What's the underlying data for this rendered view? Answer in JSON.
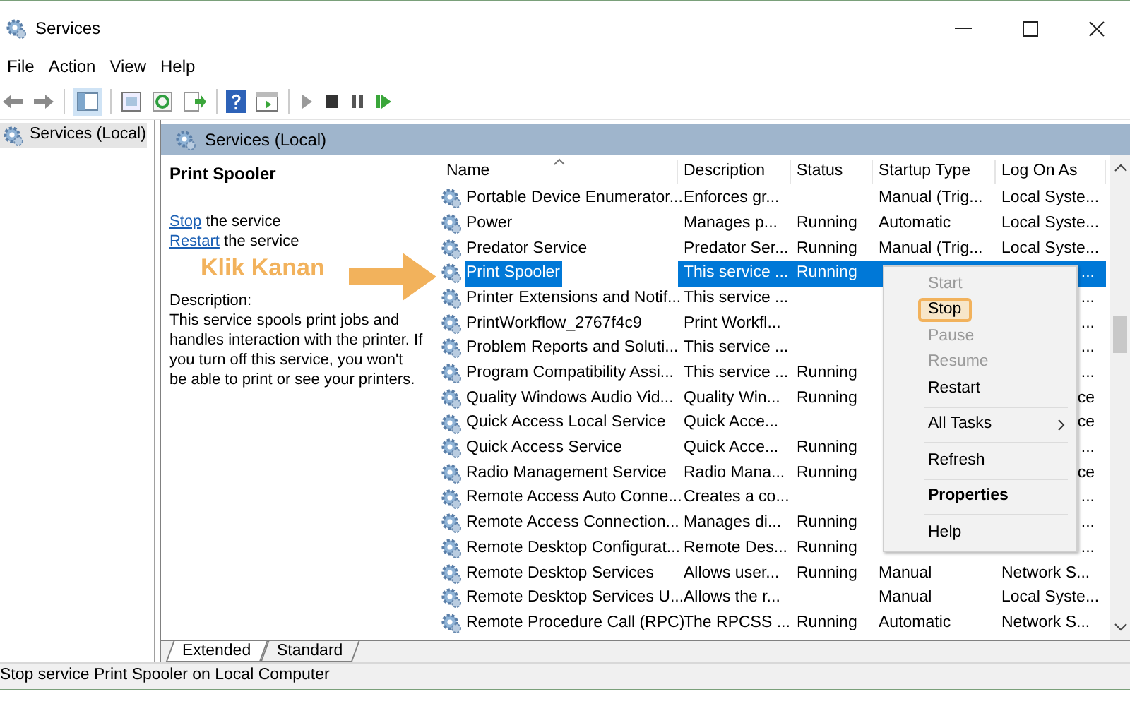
{
  "window": {
    "title": "Services"
  },
  "menu_bar": [
    "File",
    "Action",
    "View",
    "Help"
  ],
  "tree": [
    {
      "label": "Services (Local)",
      "selected": true
    }
  ],
  "pane_header": "Services (Local)",
  "details": {
    "title": "Print Spooler",
    "actions": [
      {
        "link": "Stop",
        "text": "the service"
      },
      {
        "link": "Restart",
        "text": "the service"
      }
    ],
    "description_label": "Description:",
    "description": "This service spools print jobs and handles interaction with the printer. If you turn off this service, you won't be able to print or see your printers."
  },
  "annotation": {
    "text": "Klik Kanan"
  },
  "table": {
    "columns": [
      "Name",
      "Description",
      "Status",
      "Startup Type",
      "Log On As"
    ],
    "rows": [
      {
        "name": "Portable Device Enumerator...",
        "description": "Enforces gr...",
        "status": "",
        "startup": "Manual (Trig...",
        "logon": "Local Syste...",
        "selected": false,
        "covered": false
      },
      {
        "name": "Power",
        "description": "Manages p...",
        "status": "Running",
        "startup": "Automatic",
        "logon": "Local Syste...",
        "selected": false,
        "covered": false
      },
      {
        "name": "Predator Service",
        "description": "Predator Ser...",
        "status": "Running",
        "startup": "Manual (Trig...",
        "logon": "Local Syste...",
        "selected": false,
        "covered": false
      },
      {
        "name": "Print Spooler",
        "description": "This service ...",
        "status": "Running",
        "startup": "",
        "logon": "...",
        "selected": true,
        "covered": true
      },
      {
        "name": "Printer Extensions and Notif...",
        "description": "This service ...",
        "status": "",
        "startup": "",
        "logon": "...",
        "selected": false,
        "covered": true
      },
      {
        "name": "PrintWorkflow_2767f4c9",
        "description": "Print Workfl...",
        "status": "",
        "startup": "",
        "logon": "...",
        "selected": false,
        "covered": true
      },
      {
        "name": "Problem Reports and Soluti...",
        "description": "This service ...",
        "status": "",
        "startup": "",
        "logon": "...",
        "selected": false,
        "covered": true
      },
      {
        "name": "Program Compatibility Assi...",
        "description": "This service ...",
        "status": "Running",
        "startup": "",
        "logon": "...",
        "selected": false,
        "covered": true
      },
      {
        "name": "Quality Windows Audio Vid...",
        "description": "Quality Win...",
        "status": "Running",
        "startup": "",
        "logon": "ce",
        "selected": false,
        "covered": true
      },
      {
        "name": "Quick Access Local Service",
        "description": "Quick Acce...",
        "status": "",
        "startup": "",
        "logon": "ce",
        "selected": false,
        "covered": true
      },
      {
        "name": "Quick Access Service",
        "description": "Quick Acce...",
        "status": "Running",
        "startup": "",
        "logon": "...",
        "selected": false,
        "covered": true
      },
      {
        "name": "Radio Management Service",
        "description": "Radio Mana...",
        "status": "Running",
        "startup": "",
        "logon": "ce",
        "selected": false,
        "covered": true
      },
      {
        "name": "Remote Access Auto Conne...",
        "description": "Creates a co...",
        "status": "",
        "startup": "",
        "logon": "...",
        "selected": false,
        "covered": true
      },
      {
        "name": "Remote Access Connection...",
        "description": "Manages di...",
        "status": "Running",
        "startup": "",
        "logon": "...",
        "selected": false,
        "covered": true
      },
      {
        "name": "Remote Desktop Configurat...",
        "description": "Remote Des...",
        "status": "Running",
        "startup": "",
        "logon": "...",
        "selected": false,
        "covered": true
      },
      {
        "name": "Remote Desktop Services",
        "description": "Allows user...",
        "status": "Running",
        "startup": "Manual",
        "logon": "Network S...",
        "selected": false,
        "covered": false
      },
      {
        "name": "Remote Desktop Services U...",
        "description": "Allows the r...",
        "status": "",
        "startup": "Manual",
        "logon": "Local Syste...",
        "selected": false,
        "covered": false
      },
      {
        "name": "Remote Procedure Call (RPC)",
        "description": "The RPCSS ...",
        "status": "Running",
        "startup": "Automatic",
        "logon": "Network S...",
        "selected": false,
        "covered": false
      }
    ]
  },
  "context_menu": [
    {
      "kind": "item",
      "label": "Start",
      "disabled": true,
      "highlighted": false
    },
    {
      "kind": "item",
      "label": "Stop",
      "disabled": false,
      "highlighted": true
    },
    {
      "kind": "item",
      "label": "Pause",
      "disabled": true,
      "highlighted": false
    },
    {
      "kind": "item",
      "label": "Resume",
      "disabled": true,
      "highlighted": false
    },
    {
      "kind": "item",
      "label": "Restart",
      "disabled": false,
      "highlighted": false
    },
    {
      "kind": "separator"
    },
    {
      "kind": "submenu",
      "label": "All Tasks",
      "disabled": false,
      "highlighted": false
    },
    {
      "kind": "separator"
    },
    {
      "kind": "item",
      "label": "Refresh",
      "disabled": false,
      "highlighted": false
    },
    {
      "kind": "separator"
    },
    {
      "kind": "default",
      "label": "Properties",
      "disabled": false,
      "highlighted": false
    },
    {
      "kind": "separator"
    },
    {
      "kind": "item",
      "label": "Help",
      "disabled": false,
      "highlighted": false
    }
  ],
  "view_tabs": [
    {
      "label": "Extended",
      "selected": true
    },
    {
      "label": "Standard",
      "selected": false
    }
  ],
  "status_bar": "Stop service Print Spooler on Local Computer"
}
